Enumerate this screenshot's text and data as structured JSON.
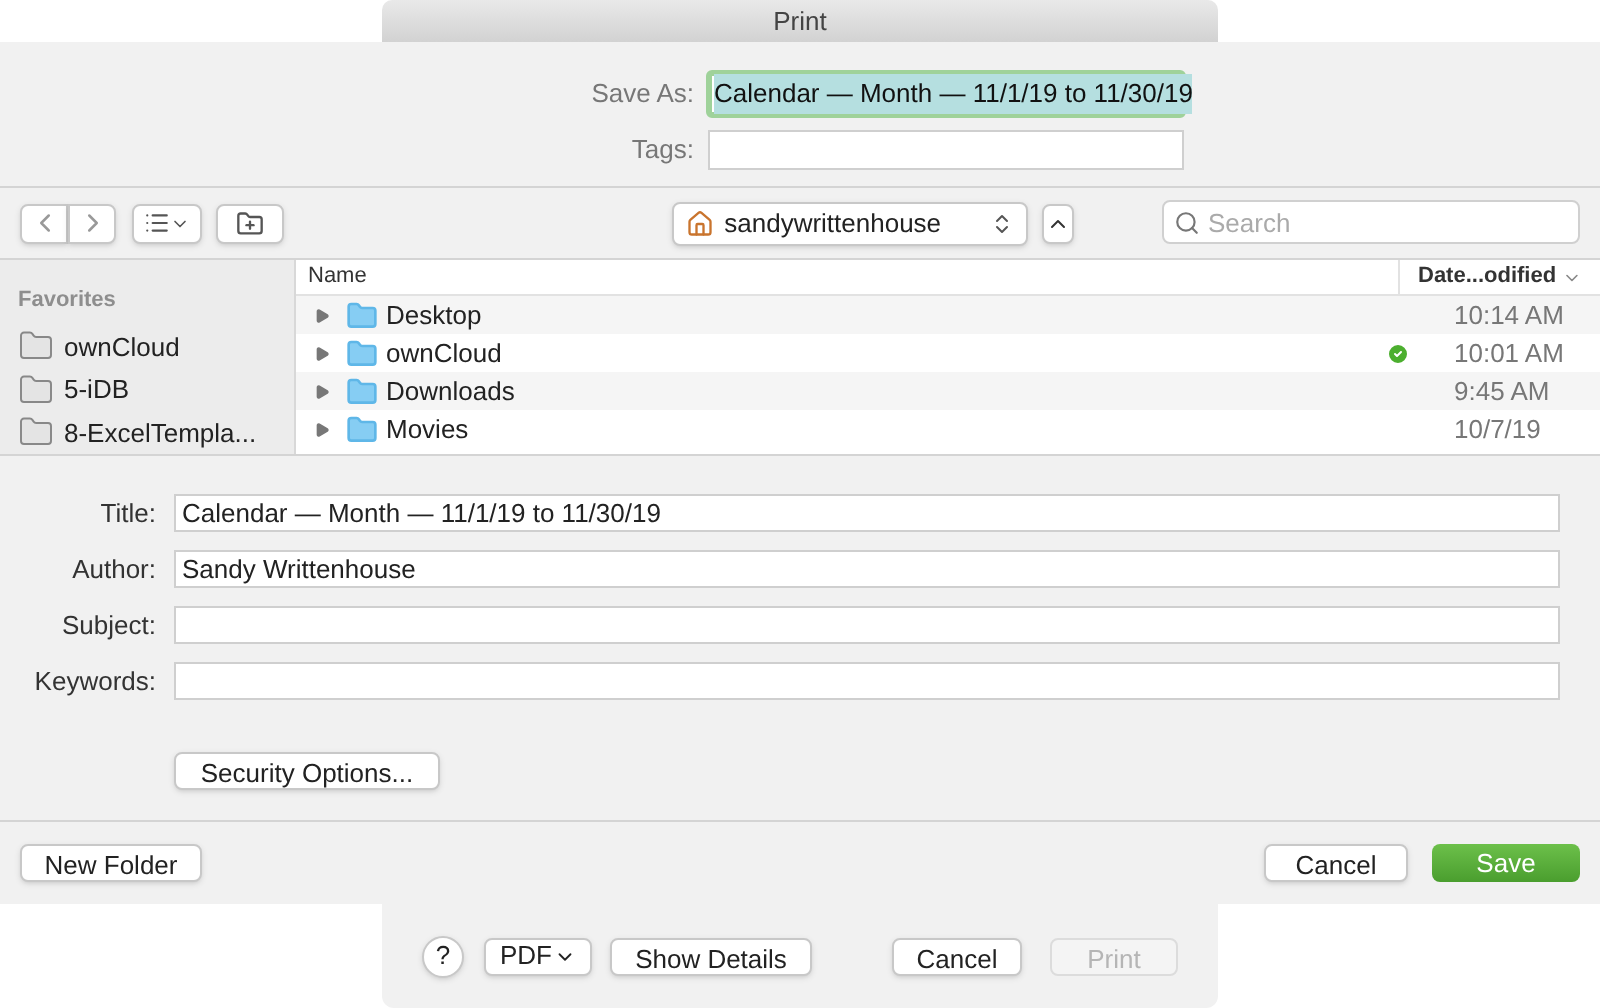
{
  "print_title": "Print",
  "save_as": {
    "label": "Save As:",
    "value": "Calendar — Month — 11/1/19 to 11/30/19",
    "selected": true
  },
  "tags": {
    "label": "Tags:"
  },
  "location": "sandywrittenhouse",
  "search": {
    "placeholder": "Search"
  },
  "sidebar": {
    "heading": "Favorites",
    "items": [
      {
        "label": "ownCloud"
      },
      {
        "label": "5-iDB"
      },
      {
        "label": "8-ExcelTempla..."
      }
    ]
  },
  "columns": [
    "Name",
    "Date...odified"
  ],
  "files": [
    {
      "name": "Desktop",
      "date": "10:14 AM",
      "synced": false
    },
    {
      "name": "ownCloud",
      "date": "10:01 AM",
      "synced": true
    },
    {
      "name": "Downloads",
      "date": "9:45 AM",
      "synced": false
    },
    {
      "name": "Movies",
      "date": "10/7/19",
      "synced": false
    }
  ],
  "fields": [
    {
      "label": "Title:",
      "value": "Calendar — Month — 11/1/19 to 11/30/19"
    },
    {
      "label": "Author:",
      "value": "Sandy Writtenhouse"
    },
    {
      "label": "Subject:"
    },
    {
      "label": "Keywords:"
    }
  ],
  "security_button": "Security Options...",
  "new_folder": "New Folder",
  "cancel": "Cancel",
  "save": "Save",
  "help": "?",
  "pdf": "PDF",
  "show_details": "Show Details",
  "print_cancel": "Cancel",
  "print": {
    "label": "Print",
    "disabled": true
  }
}
